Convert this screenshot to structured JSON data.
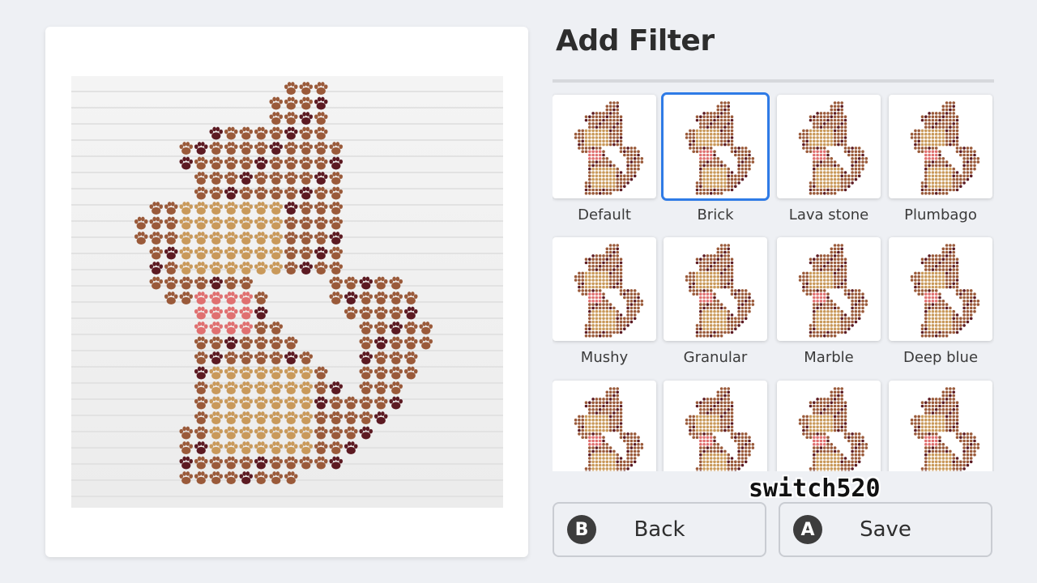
{
  "panel": {
    "title": "Add Filter"
  },
  "filters": [
    {
      "label": "Default",
      "texture": "default",
      "selected": false
    },
    {
      "label": "Brick",
      "texture": "brick",
      "selected": true
    },
    {
      "label": "Lava stone",
      "texture": "lava",
      "selected": false
    },
    {
      "label": "Plumbago",
      "texture": "plumbago",
      "selected": false
    },
    {
      "label": "Mushy",
      "texture": "mushy",
      "selected": false
    },
    {
      "label": "Granular",
      "texture": "granular",
      "selected": false
    },
    {
      "label": "Marble",
      "texture": "marble",
      "selected": false
    },
    {
      "label": "Deep blue",
      "texture": "deepblue",
      "selected": false
    },
    {
      "label": "",
      "texture": "paper",
      "selected": false
    },
    {
      "label": "",
      "texture": "soft",
      "selected": false
    },
    {
      "label": "",
      "texture": "noise",
      "selected": false
    },
    {
      "label": "",
      "texture": "sketch",
      "selected": false
    }
  ],
  "buttons": {
    "back": {
      "badge": "B",
      "label": "Back"
    },
    "save": {
      "badge": "A",
      "label": "Save"
    }
  },
  "watermark": "switch520",
  "colors": {
    "accent": "#2f7be6",
    "paw_dark": "#5c1a22",
    "paw_mid": "#9a5a3a",
    "paw_light": "#c9995a",
    "paw_pink": "#e07070"
  },
  "icons": {
    "paw": "paw-print-icon"
  }
}
